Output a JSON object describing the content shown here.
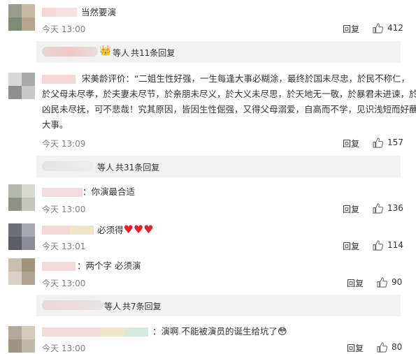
{
  "comments": [
    {
      "text": "当然要演",
      "time": "今天 13:00",
      "reply": "回复",
      "likes": "412"
    },
    {
      "text_lines": [
        "宋美龄评价：“二姐生性好强，一生每逢大事必糊涂，最终於国未尽忠，於民不称仁，",
        "於父母未尽孝，於夫妻未尽节，於亲朋未尽义，於大义未尽思，於天地无一敬，於暴君未进谏，於",
        "凶民未尽抚，可不悲哉！究其原因，皆因生性倔强，又得父母溺爱，自高而不学，见识浅短而好蘸",
        "大事。"
      ],
      "time": "今天 13:09",
      "reply": "回复",
      "likes": "157"
    },
    {
      "text": "：你演最合适",
      "time": "今天 13:00",
      "reply": "回复",
      "likes": "136"
    },
    {
      "text": "必须得",
      "time": "今天 13:01",
      "reply": "回复",
      "likes": "114"
    },
    {
      "text": "：两个字 必须演",
      "time": "今天 13:00",
      "reply": "回复",
      "likes": "90"
    },
    {
      "text": "：演啊 不能被演员的诞生给坑了",
      "time": "今天 13:00",
      "reply": "回复",
      "likes": "80"
    }
  ],
  "subreplies": [
    {
      "prefix": "等人",
      "count": "共11条回复"
    },
    {
      "prefix": "等人",
      "count": "共31条回复"
    },
    {
      "prefix": "等人",
      "count": "共7条回复"
    }
  ],
  "colors": {
    "link": "#eb7350",
    "meta": "#808080",
    "subbox_bg": "#f2f2f2"
  }
}
